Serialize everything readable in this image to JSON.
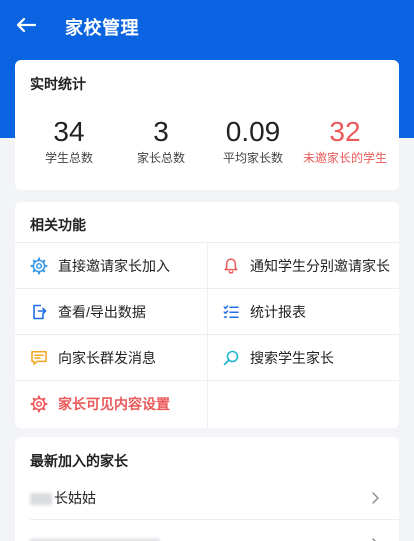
{
  "header": {
    "title": "家校管理"
  },
  "realtime": {
    "title": "实时统计",
    "stats": [
      {
        "value": "34",
        "label": "学生总数"
      },
      {
        "value": "3",
        "label": "家长总数"
      },
      {
        "value": "0.09",
        "label": "平均家长数"
      },
      {
        "value": "32",
        "label": "未邀家长的学生"
      }
    ]
  },
  "functions": {
    "title": "相关功能",
    "items": [
      {
        "label": "直接邀请家长加入",
        "icon": "gear-icon"
      },
      {
        "label": "通知学生分别邀请家长",
        "icon": "bell-icon"
      },
      {
        "label": "查看/导出数据",
        "icon": "export-icon"
      },
      {
        "label": "统计报表",
        "icon": "checklist-icon"
      },
      {
        "label": "向家长群发消息",
        "icon": "message-icon"
      },
      {
        "label": "搜索学生家长",
        "icon": "search-icon"
      },
      {
        "label": "家长可见内容设置",
        "icon": "settings-icon"
      }
    ]
  },
  "newest": {
    "title": "最新加入的家长",
    "rows": [
      {
        "name": "长姑姑"
      },
      {
        "name": ""
      }
    ]
  },
  "colors": {
    "primary": "#0a63e0",
    "danger": "#ea5a5a",
    "accent": "#3b9be8",
    "warning": "#f2a41c"
  }
}
